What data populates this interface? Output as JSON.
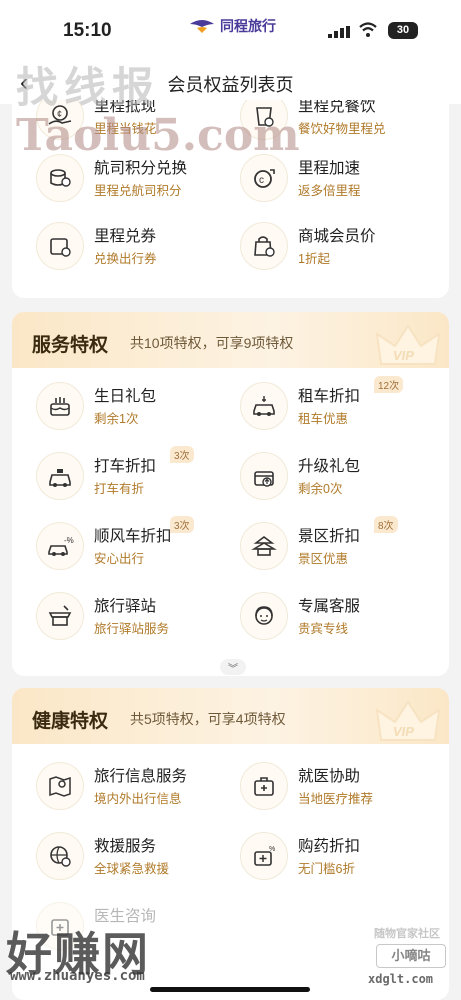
{
  "status": {
    "time": "15:10",
    "brand": "同程旅行",
    "battery": "30"
  },
  "nav": {
    "back": "‹",
    "title": "会员权益列表页"
  },
  "mileage": {
    "items": [
      {
        "title": "里程抵现",
        "sub": "里程当钱花",
        "icon": "coin-hand-icon"
      },
      {
        "title": "里程兑餐饮",
        "sub": "餐饮好物里程兑",
        "icon": "cup-icon"
      },
      {
        "title": "航司积分兑换",
        "sub": "里程兑航司积分",
        "icon": "coin-stack-icon"
      },
      {
        "title": "里程加速",
        "sub": "返多倍里程",
        "icon": "speed-coin-icon"
      },
      {
        "title": "里程兑券",
        "sub": "兑换出行券",
        "icon": "ticket-icon"
      },
      {
        "title": "商城会员价",
        "sub": "1折起",
        "icon": "shopping-bag-icon"
      }
    ]
  },
  "service": {
    "title": "服务特权",
    "summary": "共10项特权，可享9项特权",
    "items": [
      {
        "title": "生日礼包",
        "sub": "剩余1次",
        "icon": "cake-icon",
        "badge": ""
      },
      {
        "title": "租车折扣",
        "sub": "租车优惠",
        "icon": "rental-car-icon",
        "badge": "12次"
      },
      {
        "title": "打车折扣",
        "sub": "打车有折",
        "icon": "taxi-icon",
        "badge": "3次"
      },
      {
        "title": "升级礼包",
        "sub": "剩余0次",
        "icon": "gift-upgrade-icon",
        "badge": ""
      },
      {
        "title": "顺风车折扣",
        "sub": "安心出行",
        "icon": "carpool-icon",
        "badge": "3次"
      },
      {
        "title": "景区折扣",
        "sub": "景区优惠",
        "icon": "pagoda-icon",
        "badge": "8次"
      },
      {
        "title": "旅行驿站",
        "sub": "旅行驿站服务",
        "icon": "station-icon",
        "badge": ""
      },
      {
        "title": "专属客服",
        "sub": "贵宾专线",
        "icon": "headset-agent-icon",
        "badge": ""
      }
    ],
    "expand": "︾"
  },
  "health": {
    "title": "健康特权",
    "summary": "共5项特权，可享4项特权",
    "items": [
      {
        "title": "旅行信息服务",
        "sub": "境内外出行信息",
        "icon": "map-pin-icon"
      },
      {
        "title": "就医协助",
        "sub": "当地医疗推荐",
        "icon": "medical-kit-icon"
      },
      {
        "title": "救援服务",
        "sub": "全球紧急救援",
        "icon": "rescue-globe-icon"
      },
      {
        "title": "购药折扣",
        "sub": "无门槛6折",
        "icon": "pharmacy-icon"
      },
      {
        "title": "医生咨询",
        "sub": "",
        "icon": "doctor-icon"
      }
    ]
  },
  "watermarks": {
    "top_cn": "找线报",
    "top_en": "Taolu5.com",
    "bottom_cn": "好赚网",
    "bottom_url": "www.zhuanyes.com",
    "right_small": "随物官家社区",
    "right_box": "小嘀咕",
    "right_url": "xdglt.com"
  }
}
